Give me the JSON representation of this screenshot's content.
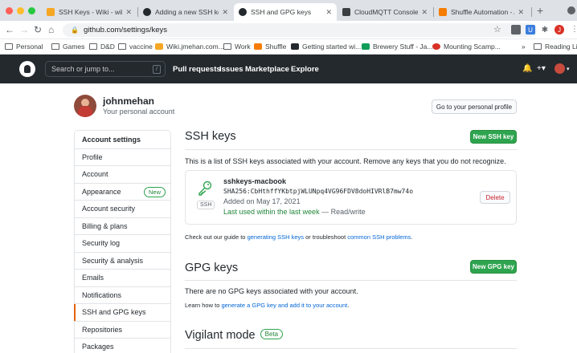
{
  "browser": {
    "tabs": [
      {
        "title": "SSH Keys - Wiki - wiki.jmeh",
        "favicon_color": "#f5a623",
        "favicon": "fire-icon"
      },
      {
        "title": "Adding a new SSH key to yo",
        "favicon_color": "#24292e",
        "favicon": "github-icon"
      },
      {
        "title": "SSH and GPG keys",
        "favicon_color": "#24292e",
        "favicon": "github-icon",
        "active": true
      },
      {
        "title": "CloudMQTT Console mikbo",
        "favicon_color": "#3c4043",
        "favicon": "cloud-icon"
      },
      {
        "title": "Shuffle Automation - An O",
        "favicon_color": "#f57c00",
        "favicon": "shuffle-icon"
      }
    ],
    "new_tab": "+",
    "url": "github.com/settings/keys",
    "bookmarks": [
      {
        "label": "Personal"
      },
      {
        "label": "Games"
      },
      {
        "label": "D&D"
      },
      {
        "label": "vaccine"
      },
      {
        "label": "Wiki.jmehan.com..."
      },
      {
        "label": "Work"
      },
      {
        "label": "Shuffle"
      },
      {
        "label": "Getting started wi..."
      },
      {
        "label": "Brewery Stuff - Ja..."
      },
      {
        "label": "Mounting Scamp..."
      }
    ],
    "bookmarks_overflow": "»",
    "reading_list": "Reading List"
  },
  "github": {
    "search_placeholder": "Search or jump to...",
    "search_shortcut": "/",
    "nav": [
      "Pull requests",
      "Issues",
      "Marketplace",
      "Explore"
    ]
  },
  "profile": {
    "username": "johnmehan",
    "subtitle": "Your personal account",
    "go_profile": "Go to your personal profile"
  },
  "sidebar": {
    "items": [
      {
        "label": "Account settings",
        "head": true
      },
      {
        "label": "Profile"
      },
      {
        "label": "Account"
      },
      {
        "label": "Appearance",
        "badge": "New"
      },
      {
        "label": "Account security"
      },
      {
        "label": "Billing & plans"
      },
      {
        "label": "Security log"
      },
      {
        "label": "Security & analysis"
      },
      {
        "label": "Emails"
      },
      {
        "label": "Notifications"
      },
      {
        "label": "SSH and GPG keys",
        "selected": true
      },
      {
        "label": "Repositories"
      },
      {
        "label": "Packages"
      }
    ]
  },
  "ssh": {
    "title": "SSH keys",
    "new_button": "New SSH key",
    "intro": "This is a list of SSH keys associated with your account. Remove any keys that you do not recognize.",
    "key": {
      "type_label": "SSH",
      "name": "sshkeys-macbook",
      "fingerprint": "SHA256:CbHthffYKbtpjWLUNpq4VG96FDV8doHIVRlB7mw74o",
      "added": "Added on May 17, 2021",
      "used_recent": "Last used within the last week",
      "used_rest": " — Read/write",
      "delete": "Delete"
    },
    "guide_prefix": "Check out our guide to ",
    "guide_link1": "generating SSH keys",
    "guide_middle": " or troubleshoot ",
    "guide_link2": "common SSH problems",
    "guide_suffix": "."
  },
  "gpg": {
    "title": "GPG keys",
    "new_button": "New GPG key",
    "empty": "There are no GPG keys associated with your account.",
    "learn_prefix": "Learn how to ",
    "learn_link": "generate a GPG key and add it to your account",
    "learn_suffix": "."
  },
  "vigilant": {
    "title": "Vigilant mode",
    "badge": "Beta"
  },
  "colors": {
    "accent_green": "#2ea44f",
    "link_blue": "#0366d6",
    "header_dark": "#24292e",
    "selected_orange": "#e36209"
  }
}
